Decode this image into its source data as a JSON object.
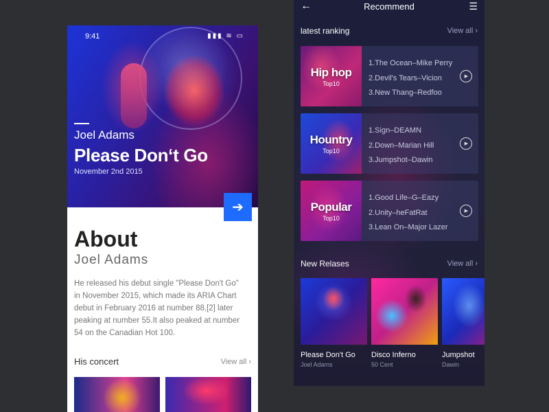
{
  "left": {
    "status": {
      "time": "9:41",
      "icons": "▮▮▮ ≋ ▭"
    },
    "hero": {
      "artist": "Joel Adams",
      "song": "Please Don‘t Go",
      "date": "November 2nd 2015",
      "go_icon": "arrow-right-icon"
    },
    "about": {
      "title": "About",
      "name": "Joel Adams",
      "body": "He released his debut single \"Please Don't Go\" in November 2015, which made its ARIA Chart debut in February 2016 at number 88,[2] later peaking at number 55.It also peaked at number 54 on the Canadian Hot 100."
    },
    "concert": {
      "title": "His concert",
      "view_all": "View all  ›"
    }
  },
  "right": {
    "title": "Recommend",
    "back_icon": "←",
    "menu_icon": "☰",
    "ranking": {
      "title": "latest ranking",
      "view_all": "View all  ›",
      "cards": [
        {
          "genre": "Hip hop",
          "badge": "Top10",
          "tracks": [
            "1.The Ocean–Mike Perry",
            "2.Devil's Tears–Vicion",
            "3.New Thang–Redfoo"
          ]
        },
        {
          "genre": "Hountry",
          "badge": "Top10",
          "tracks": [
            "1.Sign–DEAMN",
            "2.Down–Marian Hill",
            "3.Jumpshot–Dawin"
          ]
        },
        {
          "genre": "Popular",
          "badge": "Top10",
          "tracks": [
            "1.Good Life–G–Eazy",
            "2.Unity–heFatRat",
            "3.Lean On–Major Lazer"
          ]
        }
      ]
    },
    "releases": {
      "title": "New Relases",
      "view_all": "View all  ›",
      "items": [
        {
          "title": "Please Don't Go",
          "artist": "Joel Adams"
        },
        {
          "title": "Disco Inferno",
          "artist": "50 Cent"
        },
        {
          "title": "Jumpshot",
          "artist": "Dawin"
        }
      ]
    }
  },
  "colors": {
    "accent": "#1e6bff",
    "background": "#2e2f33",
    "card": "#3c416e"
  }
}
